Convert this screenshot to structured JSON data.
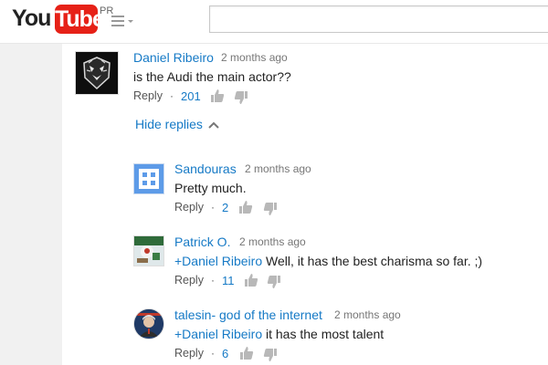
{
  "header": {
    "logo_you": "You",
    "logo_tube": "Tube",
    "logo_region": "PR",
    "search_value": "",
    "search_placeholder": ""
  },
  "comment": {
    "author": "Daniel Ribeiro",
    "time": "2 months ago",
    "text": "is the Audi the main actor??",
    "reply_label": "Reply",
    "separator": "·",
    "likes": "201"
  },
  "hide_replies_label": "Hide replies",
  "replies": [
    {
      "author": "Sandouras",
      "time": "2 months ago",
      "mention": "",
      "text": "Pretty much.",
      "reply_label": "Reply",
      "separator": "·",
      "likes": "2"
    },
    {
      "author": "Patrick O.",
      "time": "2 months ago",
      "mention": "+Daniel Ribeiro",
      "text": " Well, it has the best charisma so far. ;)",
      "reply_label": "Reply",
      "separator": "·",
      "likes": "11"
    },
    {
      "author": "talesin- god of the internet",
      "time": "2 months ago",
      "mention": "+Daniel Ribeiro",
      "text": " it has the most talent",
      "reply_label": "Reply",
      "separator": "·",
      "likes": "6"
    }
  ],
  "colors": {
    "link": "#167ac6",
    "brand_red": "#e62117",
    "page_bg": "#f1f1f1"
  },
  "icons": {
    "guide": "hamburger-menu-icon",
    "like": "thumbs-up-icon",
    "dislike": "thumbs-down-icon",
    "collapse": "chevron-up-icon"
  }
}
